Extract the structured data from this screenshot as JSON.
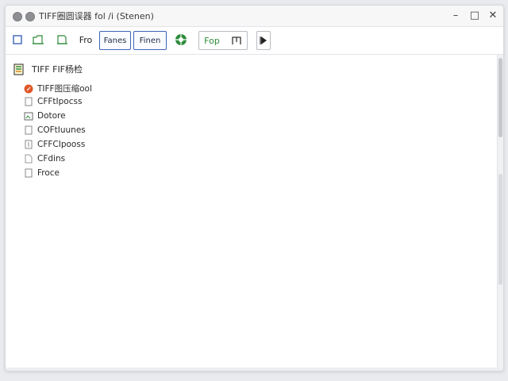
{
  "window": {
    "title": "TIFF圈圆误器 fol /i (Stenen)"
  },
  "toolbar": {
    "btn3_label": "Fro",
    "btn4_label": "Fanes",
    "btn5_label": "Finen",
    "btn7_label": "Fop",
    "accent_color": "#3d63b8",
    "green_color": "#2e8b3a"
  },
  "tree": {
    "root_label": "TIFF FIF杨检",
    "items": [
      {
        "label": "TIFF图压缩ool",
        "icon": "orange-circle-icon"
      },
      {
        "label": "CFFtIpocss",
        "icon": "file-icon"
      },
      {
        "label": "Dotore",
        "icon": "image-file-icon"
      },
      {
        "label": "COFtIuunes",
        "icon": "file-icon"
      },
      {
        "label": "CFFCIpooss",
        "icon": "file-icon"
      },
      {
        "label": "CFdins",
        "icon": "folder-file-icon"
      },
      {
        "label": "Froce",
        "icon": "file-icon"
      }
    ]
  }
}
